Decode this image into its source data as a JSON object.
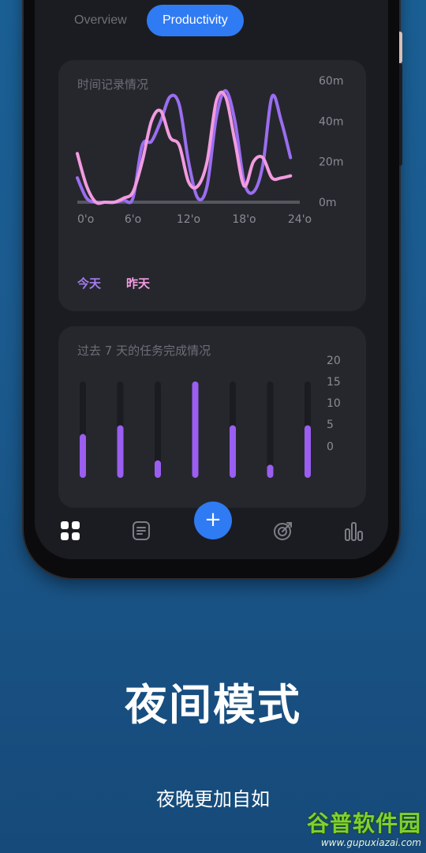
{
  "tabs": {
    "overview": "Overview",
    "productivity": "Productivity"
  },
  "time_card": {
    "title": "时间记录情况",
    "legend_today": "今天",
    "legend_yesterday": "昨天"
  },
  "task_card": {
    "title": "过去 7 天的任务完成情况"
  },
  "nav": {
    "icons": [
      "dashboard-grid-icon",
      "notes-icon",
      "plus-icon",
      "target-icon",
      "bar-chart-icon"
    ],
    "fab_label": "+"
  },
  "promo": {
    "headline": "夜间模式",
    "subline": "夜晚更加自如"
  },
  "watermark": {
    "brand": "谷普软件园",
    "url": "www.gupuxiazai.com"
  },
  "colors": {
    "accent": "#2f7bf3",
    "today": "#9a6ef0",
    "yesterday": "#f29be0",
    "card": "#26272d",
    "screen": "#1b1c21"
  },
  "chart_data": [
    {
      "type": "line",
      "title": "时间记录情况",
      "x_tick_labels": [
        "0'o",
        "6'o",
        "12'o",
        "18'o",
        "24'o"
      ],
      "y_tick_labels": [
        "60m",
        "40m",
        "20m",
        "0m"
      ],
      "ylim": [
        0,
        60
      ],
      "xlim": [
        0,
        24
      ],
      "legend": "bottom-left",
      "series": [
        {
          "name": "今天",
          "color": "#9a6ef0",
          "x": [
            0,
            1,
            2,
            3,
            4,
            5,
            6,
            7,
            8,
            9,
            10,
            11,
            12,
            13,
            14,
            15,
            16,
            17,
            18,
            19,
            20,
            21,
            22,
            23
          ],
          "y": [
            12,
            2,
            0,
            0,
            0,
            1,
            2,
            28,
            30,
            40,
            52,
            48,
            20,
            2,
            8,
            42,
            55,
            40,
            10,
            5,
            18,
            52,
            40,
            22
          ]
        },
        {
          "name": "昨天",
          "color": "#f29be0",
          "x": [
            0,
            1,
            2,
            3,
            4,
            5,
            6,
            7,
            8,
            9,
            10,
            11,
            12,
            13,
            14,
            15,
            16,
            17,
            18,
            19,
            20,
            21,
            22,
            23
          ],
          "y": [
            24,
            8,
            0,
            0,
            0,
            2,
            5,
            20,
            40,
            45,
            32,
            28,
            10,
            8,
            20,
            50,
            52,
            30,
            8,
            20,
            22,
            12,
            12,
            13
          ]
        }
      ]
    },
    {
      "type": "bar",
      "title": "过去 7 天的任务完成情况",
      "y_tick_labels": [
        "20",
        "15",
        "10",
        "5",
        "0"
      ],
      "ylim": [
        0,
        22
      ],
      "values": [
        10,
        12,
        4,
        22,
        12,
        3,
        12
      ]
    }
  ]
}
